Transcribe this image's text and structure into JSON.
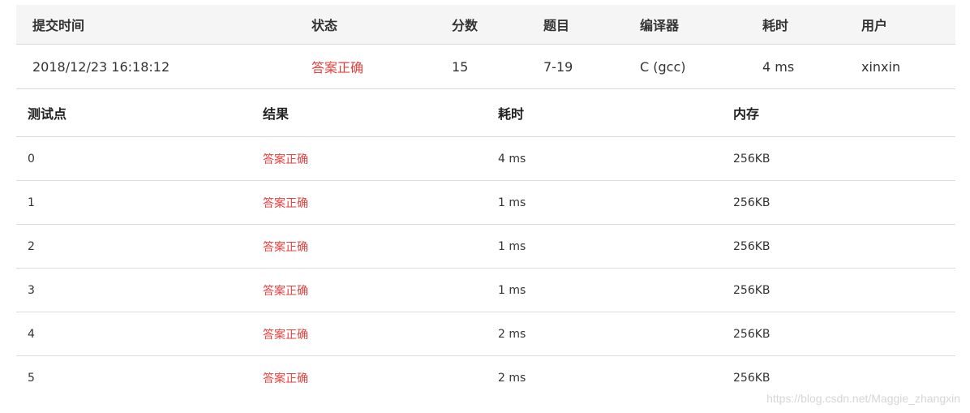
{
  "summary": {
    "headers": {
      "time": "提交时间",
      "status": "状态",
      "score": "分数",
      "problem": "题目",
      "compiler": "编译器",
      "elapsed": "耗时",
      "user": "用户"
    },
    "row": {
      "time": "2018/12/23 16:18:12",
      "status": "答案正确",
      "score": "15",
      "problem": "7-19",
      "compiler": "C (gcc)",
      "elapsed": "4 ms",
      "user": "xinxin"
    }
  },
  "details": {
    "headers": {
      "case": "测试点",
      "result": "结果",
      "elapsed": "耗时",
      "memory": "内存"
    },
    "rows": [
      {
        "case": "0",
        "result": "答案正确",
        "elapsed": "4 ms",
        "memory": "256KB"
      },
      {
        "case": "1",
        "result": "答案正确",
        "elapsed": "1 ms",
        "memory": "256KB"
      },
      {
        "case": "2",
        "result": "答案正确",
        "elapsed": "1 ms",
        "memory": "256KB"
      },
      {
        "case": "3",
        "result": "答案正确",
        "elapsed": "1 ms",
        "memory": "256KB"
      },
      {
        "case": "4",
        "result": "答案正确",
        "elapsed": "2 ms",
        "memory": "256KB"
      },
      {
        "case": "5",
        "result": "答案正确",
        "elapsed": "2 ms",
        "memory": "256KB"
      }
    ]
  },
  "colors": {
    "accept": "#e4403e",
    "header_bg": "#f5f5f5"
  },
  "watermark": "https://blog.csdn.net/Maggie_zhangxin"
}
